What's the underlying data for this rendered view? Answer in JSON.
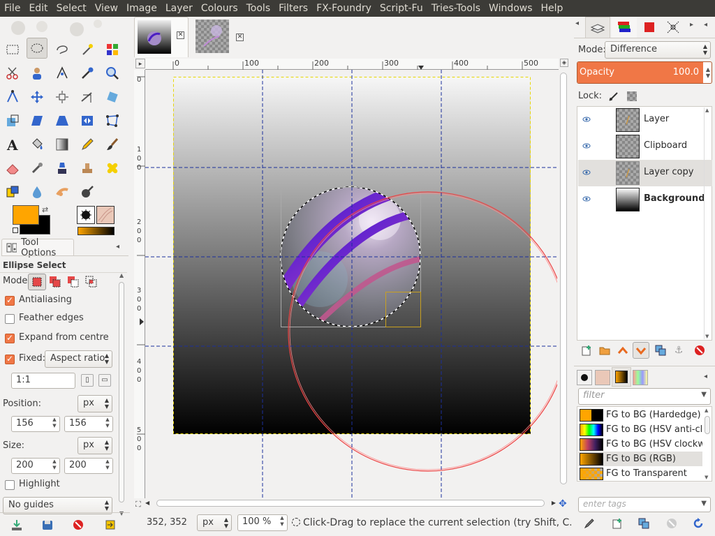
{
  "menu": [
    "File",
    "Edit",
    "Select",
    "View",
    "Image",
    "Layer",
    "Colours",
    "Tools",
    "Filters",
    "FX-Foundry",
    "Script-Fu",
    "Tries-Tools",
    "Windows",
    "Help"
  ],
  "colors": {
    "fg": "#ffa500",
    "bg": "#000000",
    "accent": "#f07746",
    "menubar": "#3c3b37"
  },
  "tool_options": {
    "tab_label": "Tool Options",
    "title": "Ellipse Select",
    "mode_label": "Mode:",
    "antialiasing": "Antialiasing",
    "feather": "Feather edges",
    "expand": "Expand from centre",
    "fixed_label": "Fixed:",
    "fixed_mode": "Aspect ratio",
    "ratio_value": "1:1",
    "position_label": "Position:",
    "position_unit": "px",
    "pos_x": "156",
    "pos_y": "156",
    "size_label": "Size:",
    "size_unit": "px",
    "size_w": "200",
    "size_h": "200",
    "highlight": "Highlight",
    "guides": "No guides"
  },
  "ruler": {
    "h_labels": [
      "0",
      "100",
      "200",
      "300",
      "400",
      "500"
    ],
    "v_labels": [
      [
        "0"
      ],
      [
        "1",
        "0",
        "0"
      ],
      [
        "2",
        "0",
        "0"
      ],
      [
        "3",
        "0",
        "0"
      ],
      [
        "4",
        "0",
        "0"
      ],
      [
        "5",
        "0",
        "0"
      ]
    ]
  },
  "status": {
    "coords": "352, 352",
    "unit": "px",
    "zoom": "100 %",
    "message": "Click-Drag to replace the current selection (try Shift, C..."
  },
  "layers_panel": {
    "mode_label": "Mode:",
    "mode_value": "Difference",
    "opacity_label": "Opacity",
    "opacity_value": "100.0",
    "lock_label": "Lock:",
    "layers": [
      "Layer",
      "Clipboard",
      "Layer copy",
      "Background"
    ]
  },
  "gradients_panel": {
    "filter_placeholder": "filter",
    "tags_placeholder": "enter tags",
    "items": [
      "FG to BG (Hardedge)",
      "FG to BG (HSV anti-clockwise)",
      "FG to BG (HSV clockwise hue)",
      "FG to BG (RGB)",
      "FG to Transparent"
    ]
  }
}
